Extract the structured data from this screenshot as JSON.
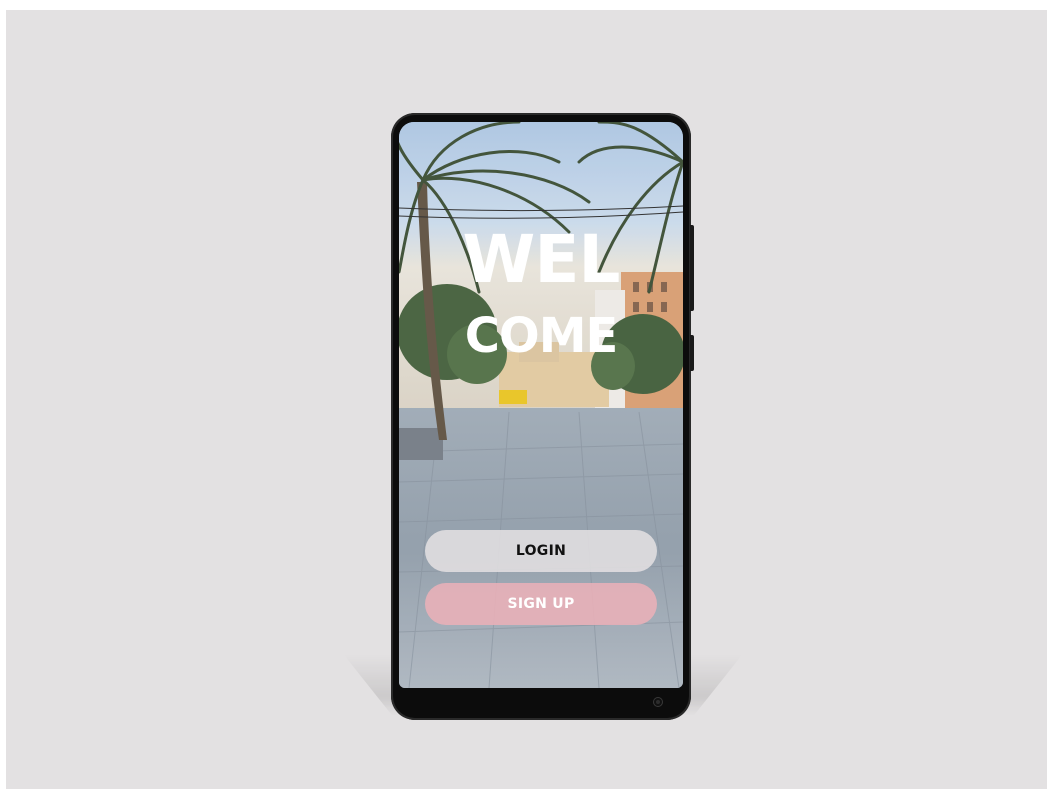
{
  "welcome": {
    "line1": "WEL",
    "line2": "COME"
  },
  "buttons": {
    "login_label": "LOGIN",
    "signup_label": "SIGN UP"
  },
  "colors": {
    "background": "#e3e1e2",
    "phone_frame": "#0c0c0c",
    "login_button": "#e2dfe1",
    "signup_button": "#e8b0b8",
    "welcome_text": "#ffffff"
  }
}
